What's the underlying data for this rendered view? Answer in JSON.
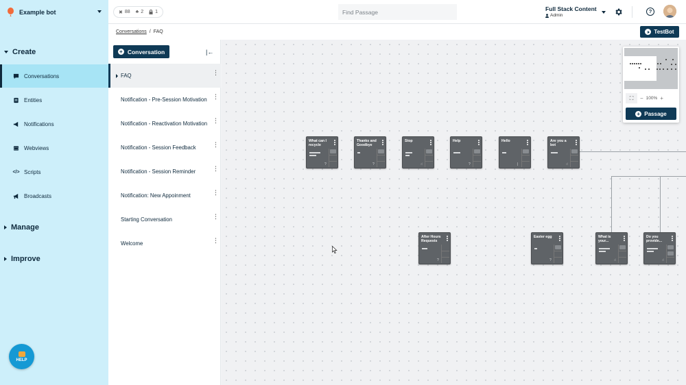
{
  "bot": {
    "name": "Example bot"
  },
  "stats": {
    "passages": "88",
    "entities": "2",
    "locks": "1"
  },
  "search": {
    "placeholder": "Find Passage"
  },
  "org": {
    "name": "Full Stack Content",
    "role": "Admin"
  },
  "help_button": {
    "label": "HELP"
  },
  "sidebar": {
    "create_label": "Create",
    "items": [
      {
        "label": "Conversations",
        "icon": "chat-icon"
      },
      {
        "label": "Entities",
        "icon": "entity-icon"
      },
      {
        "label": "Notifications",
        "icon": "megaphone-icon"
      },
      {
        "label": "Webviews",
        "icon": "window-icon"
      },
      {
        "label": "Scripts",
        "icon": "code-icon"
      },
      {
        "label": "Broadcasts",
        "icon": "broadcast-icon"
      }
    ],
    "manage_label": "Manage",
    "improve_label": "Improve"
  },
  "breadcrumb": {
    "parent": "Conversations",
    "separator": "/",
    "current": "FAQ"
  },
  "testbot_label": "TestBot",
  "conversation_button": "Conversation",
  "conversations": [
    "FAQ",
    "Notification - Pre-Session Motivation",
    "Notification - Reactivation Motivation",
    "Notification - Session Feedback",
    "Notification - Session Reminder",
    "Notification: New Appoinment",
    "Starting Conversation",
    "Welcome"
  ],
  "nodes": [
    {
      "title": "What can I recycle"
    },
    {
      "title": "Thanks and Goodbye"
    },
    {
      "title": "Stop"
    },
    {
      "title": "Help"
    },
    {
      "title": "Hello"
    },
    {
      "title": "Are you a bot"
    },
    {
      "title": "After Hours Requests"
    },
    {
      "title": "Easter egg"
    },
    {
      "title": "What is your..."
    },
    {
      "title": "Do you provide..."
    }
  ],
  "minimap": {
    "zoom": "100%",
    "passage_button": "Passage"
  },
  "colors": {
    "primary": "#0f3a56",
    "sidebar_bg": "#cdeffa",
    "sidebar_active": "#a7e4f5",
    "node_bg": "#5f6367"
  }
}
